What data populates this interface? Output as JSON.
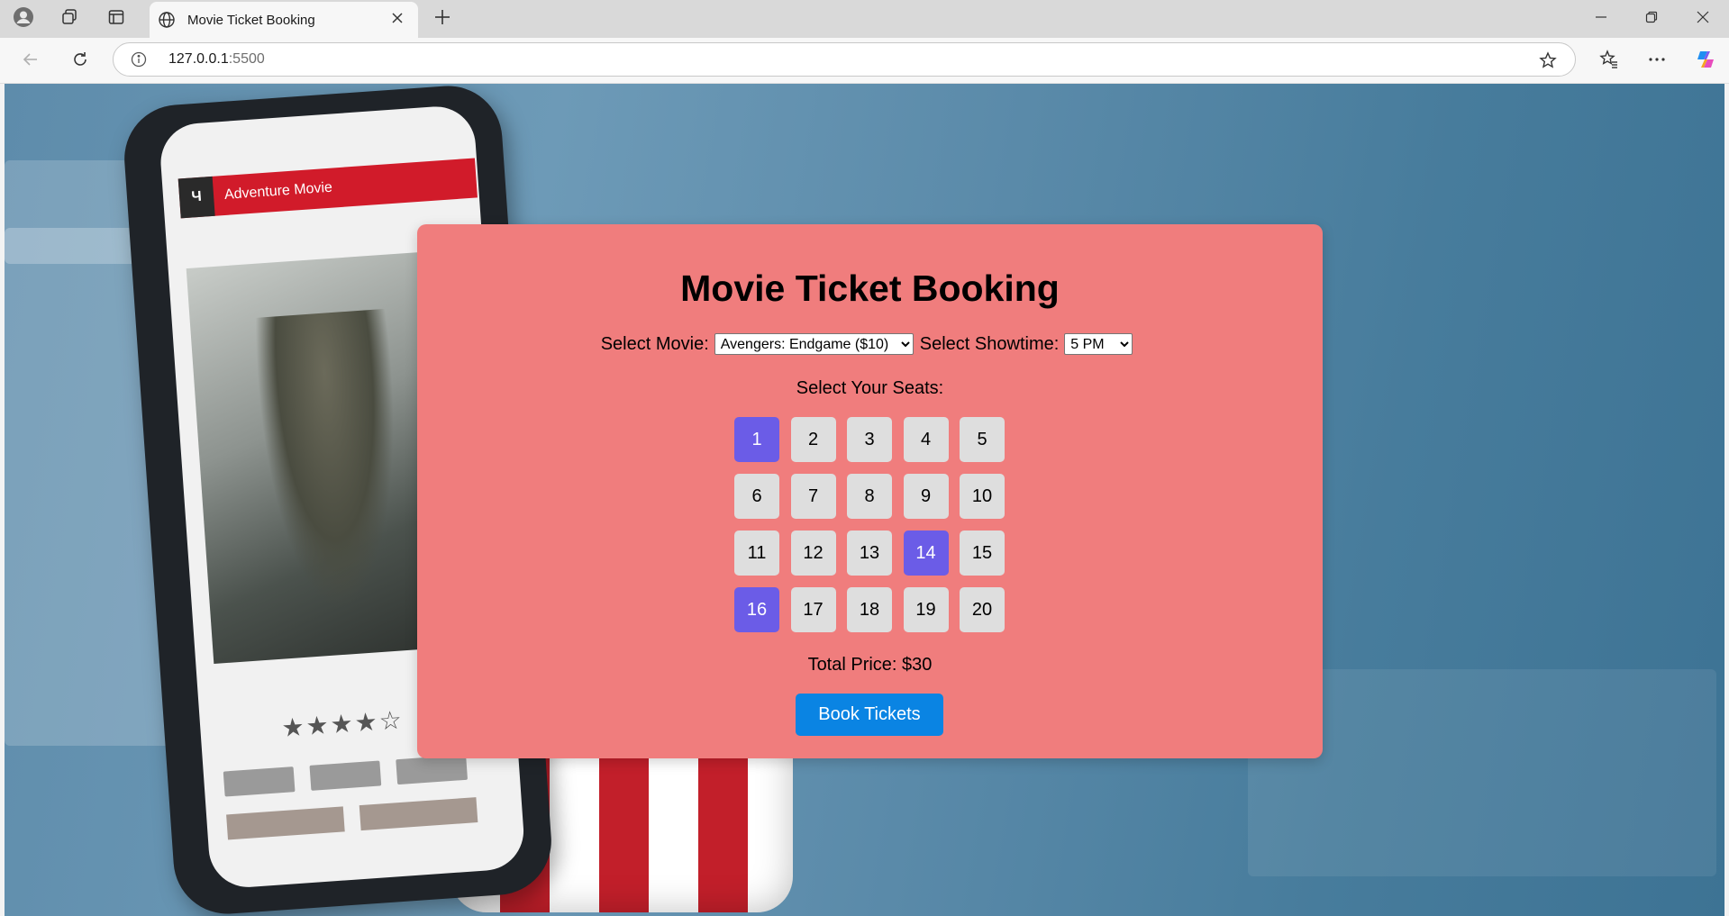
{
  "browser": {
    "tab_title": "Movie Ticket Booking",
    "url_host": "127.0.0.1",
    "url_port": ":5500"
  },
  "page": {
    "title": "Movie Ticket Booking",
    "movie_label": "Select Movie:",
    "movie_selected": "Avengers: Endgame ($10)",
    "showtime_label": "Select Showtime:",
    "showtime_selected": "5 PM",
    "seats_label": "Select Your Seats:",
    "seats": [
      {
        "label": "1",
        "selected": true
      },
      {
        "label": "2",
        "selected": false
      },
      {
        "label": "3",
        "selected": false
      },
      {
        "label": "4",
        "selected": false
      },
      {
        "label": "5",
        "selected": false
      },
      {
        "label": "6",
        "selected": false
      },
      {
        "label": "7",
        "selected": false
      },
      {
        "label": "8",
        "selected": false
      },
      {
        "label": "9",
        "selected": false
      },
      {
        "label": "10",
        "selected": false
      },
      {
        "label": "11",
        "selected": false
      },
      {
        "label": "12",
        "selected": false
      },
      {
        "label": "13",
        "selected": false
      },
      {
        "label": "14",
        "selected": true
      },
      {
        "label": "15",
        "selected": false
      },
      {
        "label": "16",
        "selected": true
      },
      {
        "label": "17",
        "selected": false
      },
      {
        "label": "18",
        "selected": false
      },
      {
        "label": "19",
        "selected": false
      },
      {
        "label": "20",
        "selected": false
      }
    ],
    "total_price": "Total Price: $30",
    "book_button": "Book Tickets"
  },
  "background_image": {
    "phone_header_text": "Adventure Movie"
  },
  "colors": {
    "card_background": "#f07d7d",
    "seat_default": "#dedede",
    "seat_selected": "#6b5ce7",
    "book_button": "#0a84e3"
  }
}
